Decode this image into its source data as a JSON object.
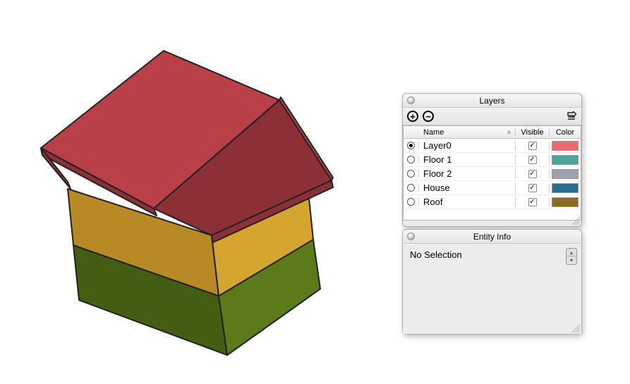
{
  "model": {
    "roof_color_light": "#b94049",
    "roof_color_dark": "#8d2f36",
    "mid_color_light": "#d4a52f",
    "mid_color_dark": "#b88a24",
    "base_color_light": "#5d7a1b",
    "base_color_dark": "#435d12",
    "edge_color": "#222222"
  },
  "layers_panel": {
    "title": "Layers",
    "columns": {
      "name": "Name",
      "visible": "Visible",
      "color": "Color"
    },
    "rows": [
      {
        "name": "Layer0",
        "active": true,
        "visible": true,
        "color": "#ed6b6e"
      },
      {
        "name": "Floor 1",
        "active": false,
        "visible": true,
        "color": "#4aa69a"
      },
      {
        "name": "Floor 2",
        "active": false,
        "visible": true,
        "color": "#9f9fb0"
      },
      {
        "name": "House",
        "active": false,
        "visible": true,
        "color": "#2a6d93"
      },
      {
        "name": "Roof",
        "active": false,
        "visible": true,
        "color": "#8a6b1f"
      }
    ]
  },
  "entity_panel": {
    "title": "Entity Info",
    "status": "No Selection"
  }
}
